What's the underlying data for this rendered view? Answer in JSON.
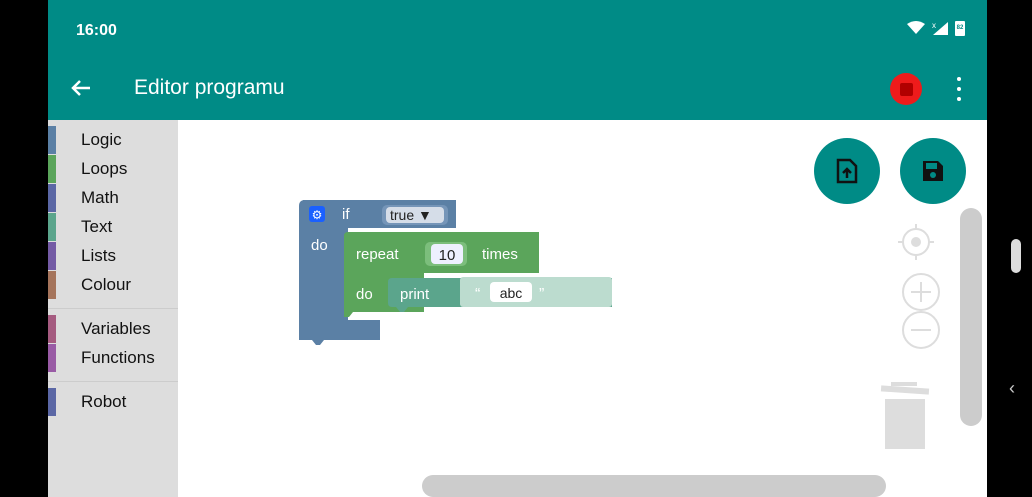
{
  "status": {
    "time": "16:00",
    "battery": "82"
  },
  "appbar": {
    "title": "Editor programu",
    "back_icon": "arrow-left-icon",
    "stop_icon": "stop-icon",
    "menu_icon": "more-vert-icon"
  },
  "toolbox": {
    "categories": [
      {
        "label": "Logic",
        "color": "#5b80a5"
      },
      {
        "label": "Loops",
        "color": "#5ba55b"
      },
      {
        "label": "Math",
        "color": "#5b67a5"
      },
      {
        "label": "Text",
        "color": "#5ba58c"
      },
      {
        "label": "Lists",
        "color": "#745ba5"
      },
      {
        "label": "Colour",
        "color": "#a5745b"
      },
      {
        "label": "Variables",
        "color": "#a55b80"
      },
      {
        "label": "Functions",
        "color": "#995ba5"
      },
      {
        "label": "Robot",
        "color": "#5b67a5"
      }
    ]
  },
  "blocks": {
    "if_label": "if",
    "if_value": "true ▼",
    "do_label": "do",
    "repeat_label": "repeat",
    "repeat_count": "10",
    "times_label": "times",
    "inner_do_label": "do",
    "print_label": "print",
    "text_open_quote": "“",
    "text_value": "abc",
    "text_close_quote": "”"
  },
  "colors": {
    "accent": "#008b86",
    "logic": "#5b80a5",
    "loops": "#5ba55b",
    "text": "#5ba58c",
    "stop": "#ee1b1b"
  }
}
